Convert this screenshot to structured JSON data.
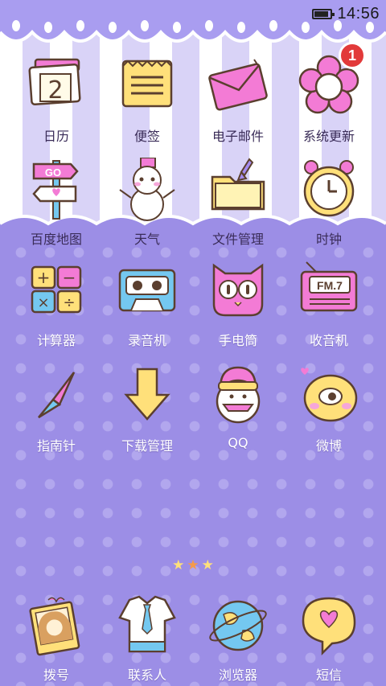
{
  "status_bar": {
    "time": "14:56"
  },
  "apps": [
    {
      "label": "日历",
      "icon": "calendar-icon",
      "icon_text": "2"
    },
    {
      "label": "便签",
      "icon": "notepad-icon"
    },
    {
      "label": "电子邮件",
      "icon": "envelope-icon"
    },
    {
      "label": "系统更新",
      "icon": "flower-update-icon",
      "badge": "1"
    },
    {
      "label": "百度地图",
      "icon": "signpost-map-icon",
      "icon_text": "GO"
    },
    {
      "label": "天气",
      "icon": "snowman-weather-icon"
    },
    {
      "label": "文件管理",
      "icon": "folder-icon"
    },
    {
      "label": "时钟",
      "icon": "alarm-clock-icon"
    },
    {
      "label": "计算器",
      "icon": "calculator-icon"
    },
    {
      "label": "录音机",
      "icon": "cassette-recorder-icon"
    },
    {
      "label": "手电筒",
      "icon": "owl-flashlight-icon"
    },
    {
      "label": "收音机",
      "icon": "radio-icon",
      "icon_text": "FM.7"
    },
    {
      "label": "指南针",
      "icon": "compass-needle-icon"
    },
    {
      "label": "下载管理",
      "icon": "download-arrow-icon"
    },
    {
      "label": "QQ",
      "icon": "qq-penguin-icon"
    },
    {
      "label": "微博",
      "icon": "weibo-eye-icon"
    }
  ],
  "page_indicator": {
    "pages": 3,
    "current": 2
  },
  "dock": [
    {
      "label": "拨号",
      "icon": "phone-photo-icon"
    },
    {
      "label": "联系人",
      "icon": "contacts-shirt-icon"
    },
    {
      "label": "浏览器",
      "icon": "globe-browser-icon"
    },
    {
      "label": "短信",
      "icon": "heart-message-icon"
    }
  ],
  "colors": {
    "background": "#9c8ee6",
    "stripe_light": "#d9d3f7",
    "badge": "#e23a3a"
  }
}
